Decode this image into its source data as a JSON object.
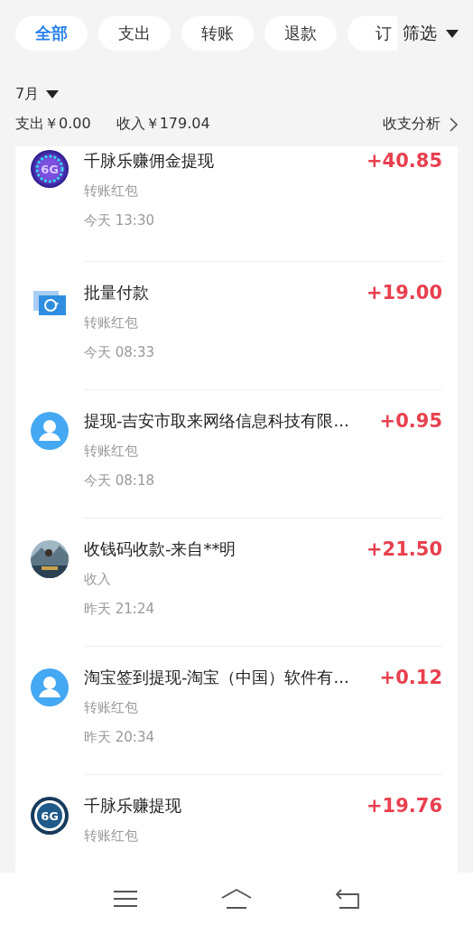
{
  "filter_tabs": [
    {
      "label": "全部",
      "selected": true
    },
    {
      "label": "支出",
      "selected": false
    },
    {
      "label": "转账",
      "selected": false
    },
    {
      "label": "退款",
      "selected": false
    },
    {
      "label": "订",
      "selected": false
    }
  ],
  "filter_button": {
    "label": "筛选"
  },
  "month": {
    "label": "7月"
  },
  "summary": {
    "expense": "支出￥0.00",
    "income": "收入￥179.04",
    "analysis": "收支分析"
  },
  "transactions": [
    {
      "kind": "ring-logo",
      "logo_text": "6G",
      "title": "千脉乐赚佣金提现",
      "category": "转账红包",
      "time": "今天 13:30",
      "amount": "+40.85"
    },
    {
      "kind": "batch",
      "title": "批量付款",
      "category": "转账红包",
      "time": "今天 08:33",
      "amount": "+19.00"
    },
    {
      "kind": "person",
      "title": "提现-吉安市取来网络信息科技有限...",
      "category": "转账红包",
      "time": "今天 08:18",
      "amount": "+0.95"
    },
    {
      "kind": "picture",
      "title": "收钱码收款-来自**明",
      "category": "收入",
      "time": "昨天 21:24",
      "amount": "+21.50"
    },
    {
      "kind": "person",
      "title": "淘宝签到提现-淘宝（中国）软件有...",
      "category": "转账红包",
      "time": "昨天 20:34",
      "amount": "+0.12"
    },
    {
      "kind": "badge-logo",
      "logo_text": "6G",
      "title": "千脉乐赚提现",
      "category": "转账红包",
      "amount": "+19.76"
    }
  ]
}
